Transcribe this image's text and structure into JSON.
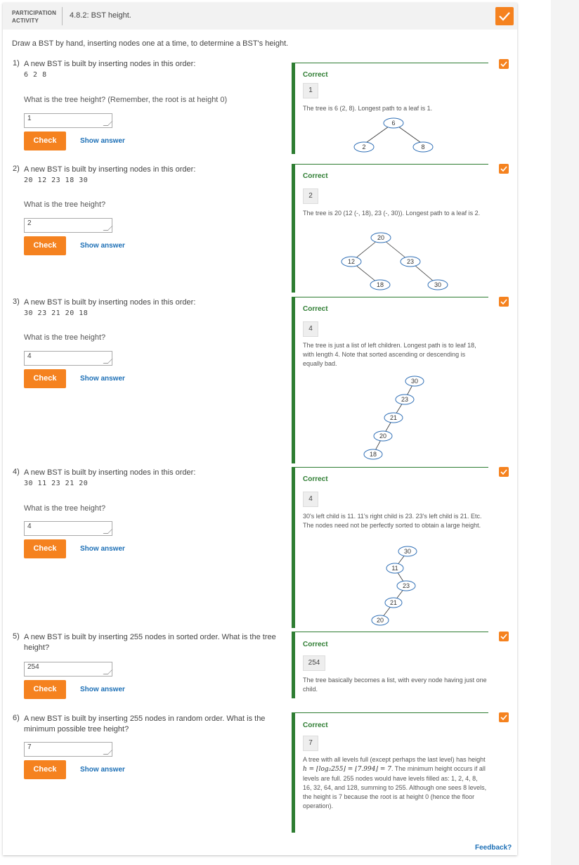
{
  "activity": {
    "type_line1": "PARTICIPATION",
    "type_line2": "ACTIVITY",
    "title": "4.8.2: BST height.",
    "instructions": "Draw a BST by hand, inserting nodes one at a time, to determine a BST's height.",
    "accent_color": "#f5821f",
    "correct_color": "#2e7d32",
    "check_label": "Check",
    "show_answer_label": "Show answer",
    "correct_label": "Correct",
    "feedback_link": "Feedback?"
  },
  "questions": [
    {
      "num": "1)",
      "prompt": "A new BST is built by inserting nodes in this order:",
      "sequence": "6  2  8",
      "subprompt": "What is the tree height? (Remember, the root is at height 0)",
      "input_value": "1",
      "answer": "1",
      "explanation": "The tree is 6 (2, 8). Longest path to a leaf is 1.",
      "tree_nodes": [
        "6",
        "2",
        "8"
      ]
    },
    {
      "num": "2)",
      "prompt": "A new BST is built by inserting nodes in this order:",
      "sequence": "20  12  23  18  30",
      "subprompt": "What is the tree height?",
      "input_value": "2",
      "answer": "2",
      "explanation": "The tree is 20 (12 (-, 18), 23 (-, 30)). Longest path to a leaf is 2.",
      "tree_nodes": [
        "20",
        "12",
        "23",
        "18",
        "30"
      ]
    },
    {
      "num": "3)",
      "prompt": "A new BST is built by inserting nodes in this order:",
      "sequence": "30  23  21  20  18",
      "subprompt": "What is the tree height?",
      "input_value": "4",
      "answer": "4",
      "explanation": "The tree is just a list of left children. Longest path is to leaf 18, with length 4. Note that sorted ascending or descending is equally bad.",
      "tree_nodes": [
        "30",
        "23",
        "21",
        "20",
        "18"
      ]
    },
    {
      "num": "4)",
      "prompt": "A new BST is built by inserting nodes in this order:",
      "sequence": "30  11  23  21  20",
      "subprompt": "What is the tree height?",
      "input_value": "4",
      "answer": "4",
      "explanation": "30's left child is 11. 11's right child is 23. 23's left child is 21. Etc. The nodes need not be perfectly sorted to obtain a large height.",
      "tree_nodes": [
        "30",
        "11",
        "23",
        "21",
        "20"
      ]
    },
    {
      "num": "5)",
      "prompt": "A new BST is built by inserting 255 nodes in sorted order. What is the tree height?",
      "input_value": "254",
      "answer": "254",
      "explanation": "The tree basically becomes a list, with every node having just one child."
    },
    {
      "num": "6)",
      "prompt": "A new BST is built by inserting 255 nodes in random order. What is the minimum possible tree height?",
      "input_value": "7",
      "answer": "7",
      "explanation_parts": {
        "a": "A tree with all levels full (except perhaps the last level) has height ",
        "formula": "h = ⌊log₂255⌋ = ⌊7.994⌋ = 7",
        "b": ". The minimum height occurs if all levels are full. 255 nodes would have levels filled as: 1, 2, 4, 8, 16, 32, 64, and 128, summing to 255. Although one sees 8 levels, the height is 7 because the root is at height 0 (hence the floor operation)."
      }
    }
  ]
}
